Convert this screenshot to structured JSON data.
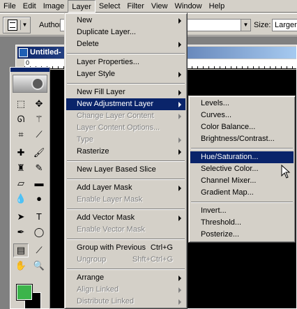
{
  "menubar": {
    "items": [
      "File",
      "Edit",
      "Image",
      "Layer",
      "Select",
      "Filter",
      "View",
      "Window",
      "Help"
    ],
    "open_index": 3
  },
  "options": {
    "author_label": "Author:",
    "author_value": "",
    "size_label": "Size:",
    "size_value": "Larger"
  },
  "document": {
    "title": "Untitled-",
    "ruler_zero": "0"
  },
  "toolbox": {
    "foreground_color": "#3cb44b",
    "background_color": "#000000"
  },
  "layer_menu": {
    "items": [
      {
        "label": "New",
        "submenu": true
      },
      {
        "label": "Duplicate Layer..."
      },
      {
        "label": "Delete",
        "submenu": true
      },
      {
        "sep": true
      },
      {
        "label": "Layer Properties..."
      },
      {
        "label": "Layer Style",
        "submenu": true
      },
      {
        "sep": true
      },
      {
        "label": "New Fill Layer",
        "submenu": true
      },
      {
        "label": "New Adjustment Layer",
        "submenu": true,
        "highlighted": true
      },
      {
        "label": "Change Layer Content",
        "submenu": true,
        "disabled": true
      },
      {
        "label": "Layer Content Options...",
        "disabled": true
      },
      {
        "label": "Type",
        "submenu": true,
        "disabled": true
      },
      {
        "label": "Rasterize",
        "submenu": true
      },
      {
        "sep": true
      },
      {
        "label": "New Layer Based Slice"
      },
      {
        "sep": true
      },
      {
        "label": "Add Layer Mask",
        "submenu": true
      },
      {
        "label": "Enable Layer Mask",
        "disabled": true
      },
      {
        "sep": true
      },
      {
        "label": "Add Vector Mask",
        "submenu": true
      },
      {
        "label": "Enable Vector Mask",
        "disabled": true
      },
      {
        "sep": true
      },
      {
        "label": "Group with Previous",
        "shortcut": "Ctrl+G"
      },
      {
        "label": "Ungroup",
        "shortcut": "Shft+Ctrl+G",
        "disabled": true
      },
      {
        "sep": true
      },
      {
        "label": "Arrange",
        "submenu": true
      },
      {
        "label": "Align Linked",
        "submenu": true,
        "disabled": true
      },
      {
        "label": "Distribute Linked",
        "submenu": true,
        "disabled": true
      }
    ]
  },
  "adjustment_menu": {
    "items": [
      {
        "label": "Levels..."
      },
      {
        "label": "Curves..."
      },
      {
        "label": "Color Balance..."
      },
      {
        "label": "Brightness/Contrast..."
      },
      {
        "sep": true
      },
      {
        "label": "Hue/Saturation...",
        "highlighted": true
      },
      {
        "label": "Selective Color..."
      },
      {
        "label": "Channel Mixer..."
      },
      {
        "label": "Gradient Map..."
      },
      {
        "sep": true
      },
      {
        "label": "Invert..."
      },
      {
        "label": "Threshold..."
      },
      {
        "label": "Posterize..."
      }
    ]
  }
}
